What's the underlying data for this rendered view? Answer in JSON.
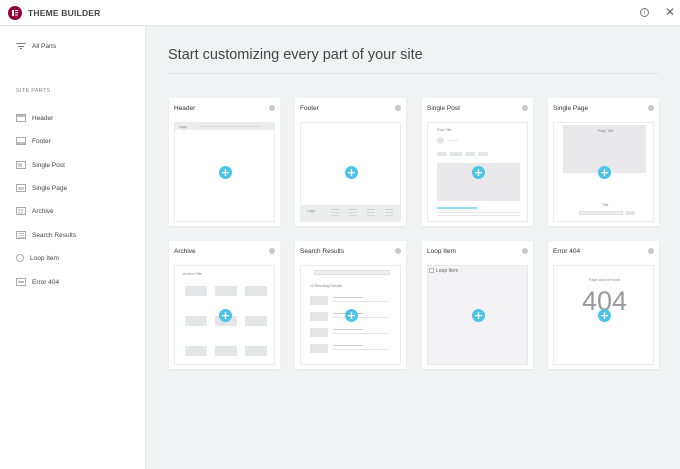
{
  "app": {
    "title": "THEME BUILDER"
  },
  "header_icons": {
    "info": "info-icon",
    "close": "close-icon"
  },
  "sidebar": {
    "all_parts_label": "All Parts",
    "section_label": "SITE PARTS",
    "items": [
      {
        "label": "Header"
      },
      {
        "label": "Footer"
      },
      {
        "label": "Single Post"
      },
      {
        "label": "Single Page"
      },
      {
        "label": "Archive"
      },
      {
        "label": "Search Results"
      },
      {
        "label": "Loop Item"
      },
      {
        "label": "Error 404"
      }
    ]
  },
  "main": {
    "title": "Start customizing every part of your site",
    "cards": [
      {
        "title": "Header"
      },
      {
        "title": "Footer"
      },
      {
        "title": "Single Post"
      },
      {
        "title": "Single Page"
      },
      {
        "title": "Archive"
      },
      {
        "title": "Search Results"
      },
      {
        "title": "Loop Item"
      },
      {
        "title": "Error 404"
      }
    ],
    "previews": {
      "header_logo": "Logo",
      "footer_logo": "Logo",
      "post_title": "Post Title",
      "page_title": "Page Title",
      "page_title2": "Title",
      "archive_title": "Archive Title",
      "search_results": "12 Resulting Results",
      "loop_item_alt": "Loop Item",
      "error_text": "Page was not found",
      "error_code": "404"
    }
  },
  "colors": {
    "accent": "#4ec3e8",
    "brand": "#92003b"
  }
}
